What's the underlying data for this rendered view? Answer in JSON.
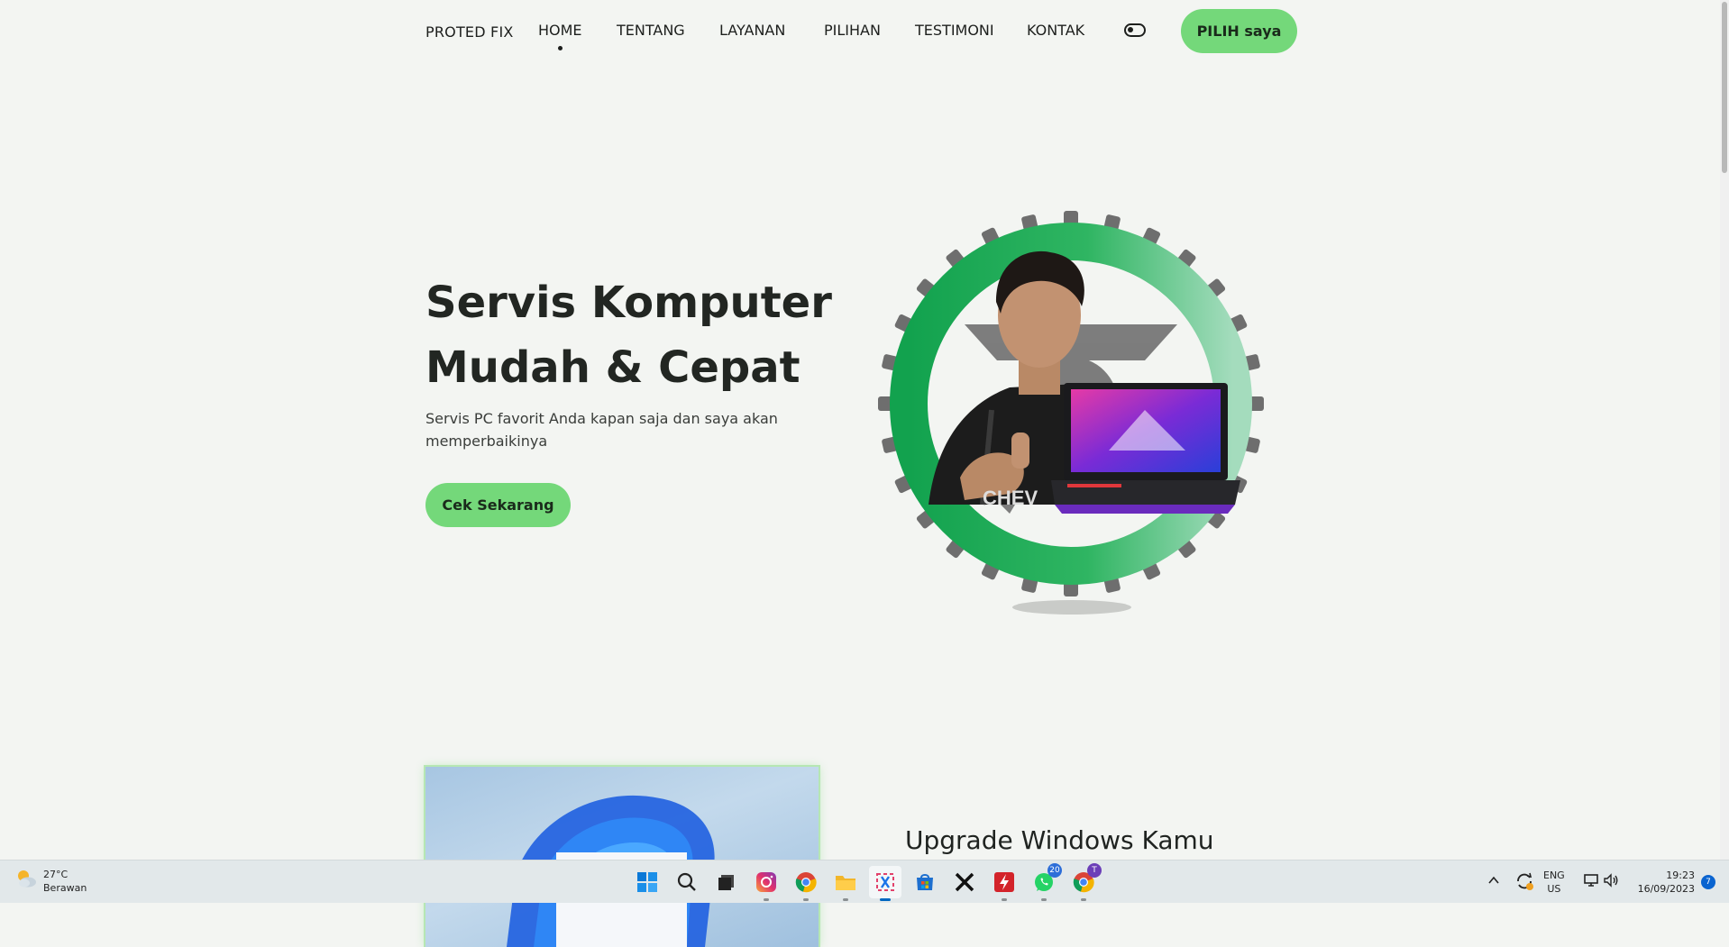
{
  "navbar": {
    "brand": "PROTED FIX",
    "menu": [
      "HOME",
      "TENTANG",
      "LAYANAN",
      "PILIHAN",
      "TESTIMONI",
      "KONTAK"
    ],
    "active_item": "HOME",
    "cta": "PILIH saya"
  },
  "hero": {
    "title_line1": "Servis Komputer",
    "title_line2": "Mudah & Cepat",
    "subtitle": "Servis PC favorit Anda kapan saja dan saya akan memperbaikinya",
    "button": "Cek Sekarang"
  },
  "section2": {
    "title": "Upgrade Windows Kamu"
  },
  "taskbar": {
    "weather": {
      "temp": "27°C",
      "condition": "Berawan"
    },
    "apps": [
      {
        "name": "start-icon"
      },
      {
        "name": "search-icon"
      },
      {
        "name": "task-view-icon"
      },
      {
        "name": "instagram-icon"
      },
      {
        "name": "chrome-icon"
      },
      {
        "name": "file-explorer-icon"
      },
      {
        "name": "snipping-tool-icon"
      },
      {
        "name": "store-icon"
      },
      {
        "name": "x-icon"
      },
      {
        "name": "flash-app-icon"
      },
      {
        "name": "whatsapp-icon",
        "badge": "20"
      },
      {
        "name": "chrome-profile-icon",
        "badge": "T"
      }
    ],
    "lang_line1": "ENG",
    "lang_line2": "US",
    "time": "19:23",
    "date": "16/09/2023",
    "notifications": "7"
  },
  "colors": {
    "accent_green": "#74d87a",
    "ring_green": "#1fae57",
    "gear_gray": "#6e6e6e",
    "background": "#f3f5f2"
  }
}
